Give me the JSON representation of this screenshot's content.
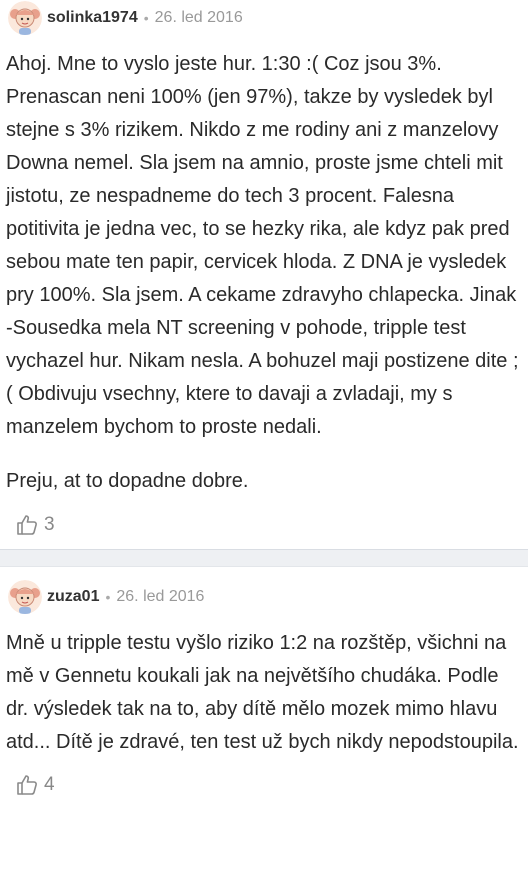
{
  "comments": [
    {
      "author": "solinka1974",
      "date": "26. led 2016",
      "paragraphs": [
        "Ahoj. Mne to vyslo jeste hur. 1:30 :( Coz jsou 3%. Prenascan neni 100% (jen 97%), takze by vysledek byl stejne s 3% rizikem. Nikdo z me rodiny ani z manzelovy Downa nemel. Sla jsem na amnio, proste jsme chteli mit jistotu, ze nespadneme do tech 3 procent. Falesna potitivita je jedna vec, to se hezky rika, ale kdyz pak pred sebou mate ten papir, cervicek hloda. Z DNA je vysledek pry 100%. Sla jsem. A cekame zdravyho chlapecka. Jinak -Sousedka mela NT screening v pohode, tripple test vychazel hur. Nikam nesla. A bohuzel maji postizene dite ;( Obdivuju vsechny, ktere to davaji a zvladaji, my s manzelem bychom to proste nedali.",
        "Preju, at to dopadne dobre."
      ],
      "likes": "3"
    },
    {
      "author": "zuza01",
      "date": "26. led 2016",
      "paragraphs": [
        "Mně u tripple testu vyšlo riziko 1:2 na rozštěp, všichni na mě v Gennetu koukali jak na největšího chudáka. Podle dr. výsledek tak na to, aby dítě mělo mozek mimo hlavu atd... Dítě je zdravé, ten test už bych nikdy nepodstoupila."
      ],
      "likes": "4"
    }
  ],
  "icons": {
    "avatar": "girl-avatar-icon",
    "like": "thumbs-up-icon"
  },
  "colors": {
    "text": "#2a2a2a",
    "meta": "#999999",
    "separator": "#eef0f3",
    "avatar_skin": "#f7d9c4",
    "avatar_hair": "#e8a08c"
  }
}
